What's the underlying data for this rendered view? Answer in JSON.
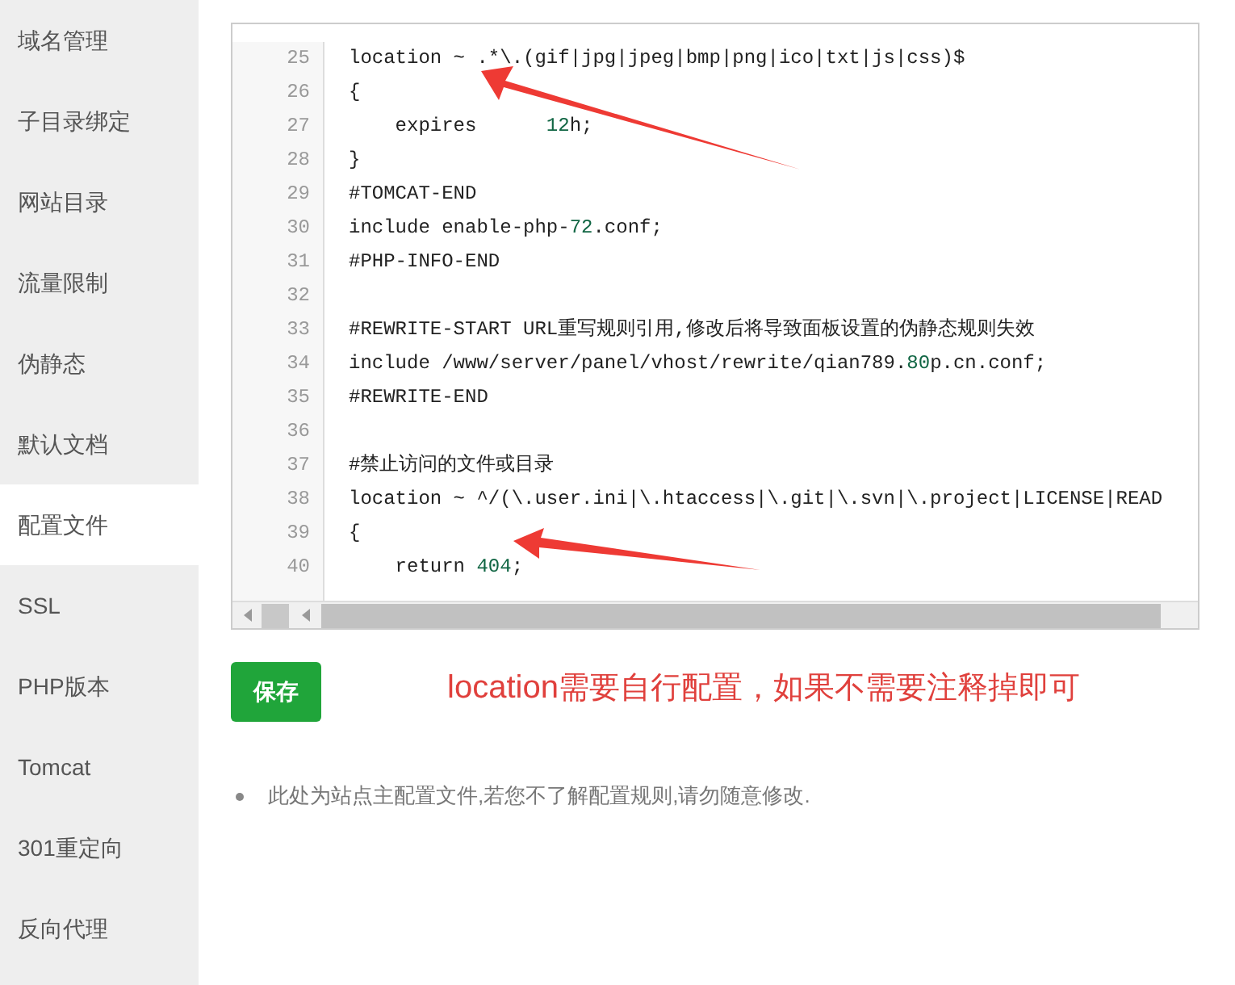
{
  "sidebar": {
    "items": [
      {
        "label": "域名管理",
        "selected": false
      },
      {
        "label": "子目录绑定",
        "selected": false
      },
      {
        "label": "网站目录",
        "selected": false
      },
      {
        "label": "流量限制",
        "selected": false
      },
      {
        "label": "伪静态",
        "selected": false
      },
      {
        "label": "默认文档",
        "selected": false
      },
      {
        "label": "配置文件",
        "selected": true
      },
      {
        "label": "SSL",
        "selected": false
      },
      {
        "label": "PHP版本",
        "selected": false
      },
      {
        "label": "Tomcat",
        "selected": false
      },
      {
        "label": "301重定向",
        "selected": false
      },
      {
        "label": "反向代理",
        "selected": false
      }
    ]
  },
  "editor": {
    "lines": [
      {
        "number": "25",
        "tokens": [
          {
            "kind": "plain",
            "text": "location ~ .*\\.(gif|jpg|jpeg|bmp|png|ico|txt|js|css)$"
          }
        ]
      },
      {
        "number": "26",
        "tokens": [
          {
            "kind": "plain",
            "text": "{"
          }
        ]
      },
      {
        "number": "27",
        "tokens": [
          {
            "kind": "plain",
            "text": "    expires      "
          },
          {
            "kind": "number",
            "text": "12"
          },
          {
            "kind": "plain",
            "text": "h;"
          }
        ]
      },
      {
        "number": "28",
        "tokens": [
          {
            "kind": "plain",
            "text": "}"
          }
        ]
      },
      {
        "number": "29",
        "tokens": [
          {
            "kind": "plain",
            "text": "#TOMCAT-END"
          }
        ]
      },
      {
        "number": "30",
        "tokens": [
          {
            "kind": "plain",
            "text": "include enable-php-"
          },
          {
            "kind": "number",
            "text": "72"
          },
          {
            "kind": "plain",
            "text": ".conf;"
          }
        ]
      },
      {
        "number": "31",
        "tokens": [
          {
            "kind": "plain",
            "text": "#PHP-INFO-END"
          }
        ]
      },
      {
        "number": "32"
      },
      {
        "number": "33",
        "tokens": [
          {
            "kind": "plain",
            "text": "#REWRITE-START URL重写规则引用,修改后将导致面板设置的伪静态规则失效"
          }
        ]
      },
      {
        "number": "34",
        "tokens": [
          {
            "kind": "plain",
            "text": "include /www/server/panel/vhost/rewrite/qian789."
          },
          {
            "kind": "number",
            "text": "80"
          },
          {
            "kind": "plain",
            "text": "p.cn.conf;"
          }
        ]
      },
      {
        "number": "35",
        "tokens": [
          {
            "kind": "plain",
            "text": "#REWRITE-END"
          }
        ]
      },
      {
        "number": "36"
      },
      {
        "number": "37",
        "tokens": [
          {
            "kind": "plain",
            "text": "#禁止访问的文件或目录"
          }
        ]
      },
      {
        "number": "38",
        "tokens": [
          {
            "kind": "plain",
            "text": "location ~ ^/(\\.user.ini|\\.htaccess|\\.git|\\.svn|\\.project|LICENSE|READ"
          }
        ]
      },
      {
        "number": "39",
        "tokens": [
          {
            "kind": "plain",
            "text": "{"
          }
        ]
      },
      {
        "number": "40",
        "tokens": [
          {
            "kind": "plain",
            "text": "    return "
          },
          {
            "kind": "number",
            "text": "404"
          },
          {
            "kind": "plain",
            "text": ";"
          }
        ]
      }
    ]
  },
  "save_button": "保存",
  "annotation": {
    "keyword": "location",
    "text": "需要自行配置，如果不需要注释掉即可"
  },
  "notes": [
    "此处为站点主配置文件,若您不了解配置规则,请勿随意修改."
  ]
}
